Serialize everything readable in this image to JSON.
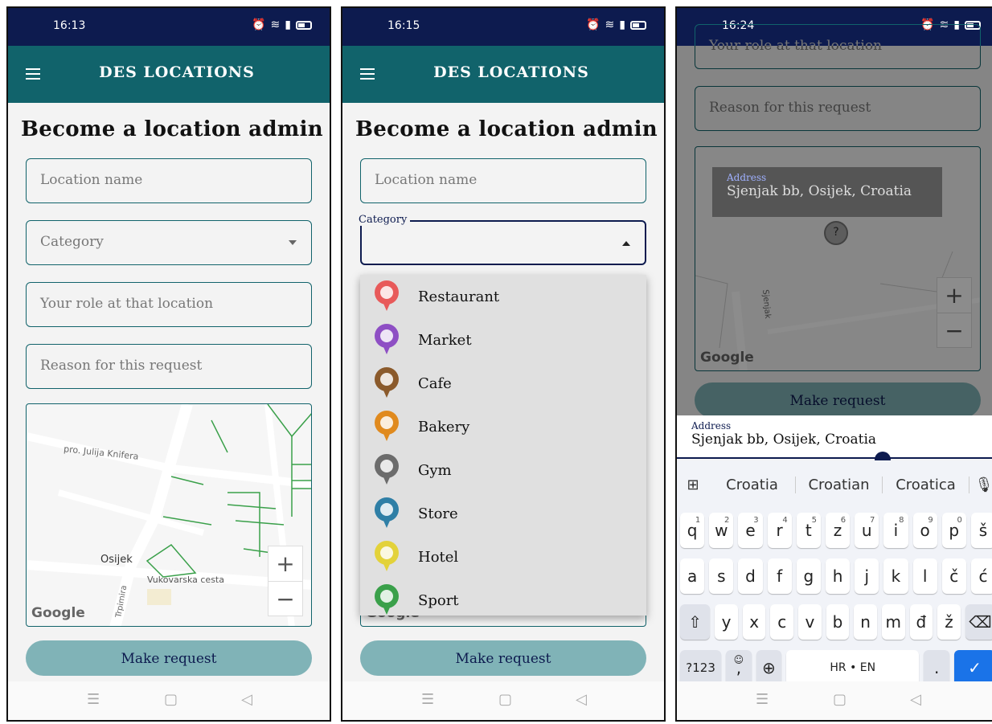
{
  "screens": [
    {
      "time": "16:13",
      "app_title": "DES LOCATIONS",
      "heading": "Become a location admin",
      "fields": {
        "location_name": "Location name",
        "category": "Category",
        "role": "Your role at that location",
        "reason": "Reason for this request"
      },
      "map": {
        "labels": [
          "pro. Julija Knifera",
          "Osijek",
          "Vukovarska cesta",
          "Trpimira"
        ],
        "logo": "Google",
        "zoom_in": "+",
        "zoom_out": "−"
      },
      "button": "Make request"
    },
    {
      "time": "16:15",
      "app_title": "DES LOCATIONS",
      "heading": "Become a location admin",
      "fields": {
        "location_name": "Location name",
        "category_legend": "Category"
      },
      "categories": [
        {
          "label": "Restaurant",
          "color": "#e85a5a"
        },
        {
          "label": "Market",
          "color": "#8e4fc4"
        },
        {
          "label": "Cafe",
          "color": "#8b5a2b"
        },
        {
          "label": "Bakery",
          "color": "#e08a1e"
        },
        {
          "label": "Gym",
          "color": "#6c6c6c"
        },
        {
          "label": "Store",
          "color": "#2f7fa6"
        },
        {
          "label": "Hotel",
          "color": "#e3d23a"
        },
        {
          "label": "Sport",
          "color": "#3aa04a"
        }
      ],
      "map": {
        "logo": "Google"
      },
      "button": "Make request"
    },
    {
      "time": "16:24",
      "fields": {
        "role": "Your role at that location",
        "reason": "Reason for this request"
      },
      "tooltip": {
        "label": "Address",
        "value": "Sjenjak bb, Osijek, Croatia"
      },
      "map": {
        "street": "Sjenjak",
        "logo": "Google",
        "zoom_in": "+",
        "zoom_out": "−",
        "marker": "?"
      },
      "button": "Make request",
      "address_input": {
        "label": "Address",
        "value": "Sjenjak bb, Osijek, Croatia"
      },
      "keyboard": {
        "suggestions": [
          "Croatia",
          "Croatian",
          "Croatica"
        ],
        "row1": [
          "q",
          "w",
          "e",
          "r",
          "t",
          "z",
          "u",
          "i",
          "o",
          "p",
          "š"
        ],
        "row1_nums": [
          "1",
          "2",
          "3",
          "4",
          "5",
          "6",
          "7",
          "8",
          "9",
          "0",
          ""
        ],
        "row2": [
          "a",
          "s",
          "d",
          "f",
          "g",
          "h",
          "j",
          "k",
          "l",
          "č",
          "ć"
        ],
        "row3": [
          "y",
          "x",
          "c",
          "v",
          "b",
          "n",
          "m",
          "đ",
          "ž"
        ],
        "symbols_key": "?123",
        "comma_key": ",",
        "space_key": "HR • EN",
        "period_key": "."
      }
    }
  ],
  "colors": {
    "status_bar": "#0d1b4f",
    "app_bar": "#11636b",
    "button": "#80b3b7",
    "accent": "#1a73e8"
  }
}
